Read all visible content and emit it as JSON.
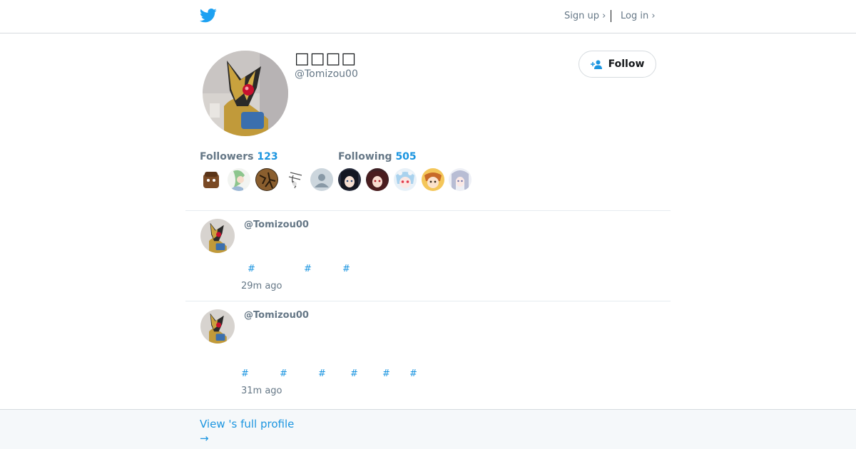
{
  "header": {
    "logo_icon": "twitter-bird-icon",
    "signup_label": "Sign up ›",
    "login_label": "Log in ›"
  },
  "profile": {
    "display_name": "□□□□",
    "handle": "@Tomizou00",
    "follow_label": "Follow",
    "follow_icon": "add-person-icon",
    "followers_label": "Followers",
    "followers_count": "123",
    "following_label": "Following",
    "following_count": "505"
  },
  "tweets": [
    {
      "handle": "@Tomizou00",
      "hashtags": [
        "#",
        "#",
        "#"
      ],
      "time": "29m ago"
    },
    {
      "handle": "@Tomizou00",
      "hashtags": [
        "#",
        "#",
        "#",
        "#",
        "#",
        "#"
      ],
      "time": "31m ago"
    }
  ],
  "footer": {
    "full_profile_label": "View 's full profile",
    "arrow": "→"
  },
  "colors": {
    "accent": "#1b95e0",
    "muted": "#657786",
    "border": "#d6dbdf",
    "footer_bg": "#f5f8fa"
  }
}
